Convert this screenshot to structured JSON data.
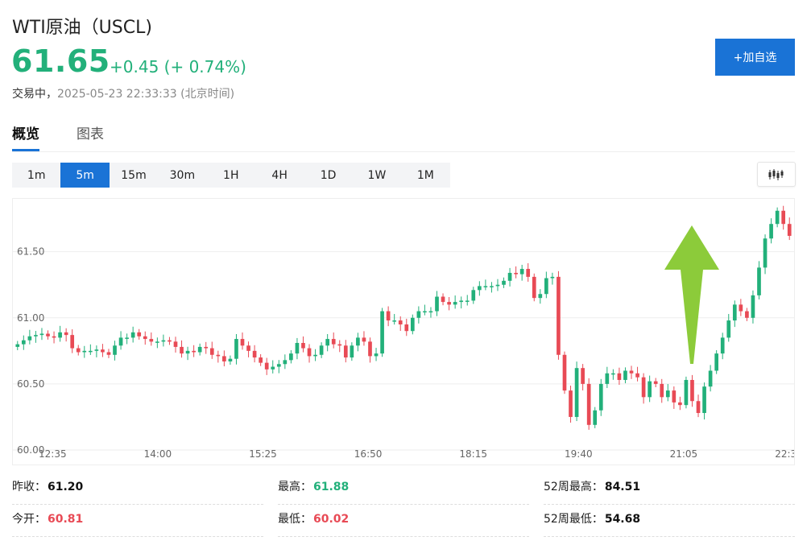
{
  "header": {
    "title": "WTI原油（USCL)",
    "price": "61.65",
    "change": "+0.45 (+ 0.74%)",
    "status_label": "交易中，",
    "timestamp": "2025-05-23 22:33:33 (北京时间)",
    "add_watch_label": "+加自选"
  },
  "tabs": [
    {
      "label": "概览",
      "active": true
    },
    {
      "label": "图表",
      "active": false
    }
  ],
  "intervals": [
    "1m",
    "5m",
    "15m",
    "30m",
    "1H",
    "4H",
    "1D",
    "1W",
    "1M"
  ],
  "active_interval": "5m",
  "chart_type_icon": "candlestick-icon",
  "colors": {
    "up": "#22b07a",
    "down": "#e84a55",
    "accent": "#1a73d6",
    "annotation_arrow": "#8ccb3a"
  },
  "chart_data": {
    "type": "candlestick",
    "y_ticks": [
      "61.50",
      "61.00",
      "60.50",
      "60.00"
    ],
    "x_ticks": [
      "12:35",
      "14:00",
      "15:25",
      "16:50",
      "18:15",
      "19:40",
      "21:05",
      "22:3"
    ],
    "ylim": [
      60.0,
      61.9
    ],
    "grid": true,
    "annotation": "green upward arrow above the candles near 21:10",
    "closes": [
      60.8,
      60.83,
      60.86,
      60.87,
      60.88,
      60.86,
      60.85,
      60.89,
      60.87,
      60.77,
      60.74,
      60.75,
      60.75,
      60.76,
      60.74,
      60.72,
      60.79,
      60.85,
      60.85,
      60.89,
      60.86,
      60.84,
      60.82,
      60.82,
      60.83,
      60.82,
      60.78,
      60.73,
      60.75,
      60.74,
      60.78,
      60.77,
      60.72,
      60.71,
      60.67,
      60.69,
      60.84,
      60.79,
      60.75,
      60.7,
      60.66,
      60.61,
      60.63,
      60.65,
      60.68,
      60.73,
      60.81,
      60.77,
      60.71,
      60.72,
      60.79,
      60.84,
      60.8,
      60.79,
      60.7,
      60.79,
      60.85,
      60.82,
      60.71,
      60.73,
      61.05,
      60.98,
      60.98,
      60.95,
      60.9,
      61.0,
      61.05,
      61.05,
      61.05,
      61.16,
      61.12,
      61.1,
      61.12,
      61.13,
      61.13,
      61.21,
      61.24,
      61.24,
      61.24,
      61.25,
      61.28,
      61.34,
      61.33,
      61.37,
      61.31,
      61.15,
      61.18,
      61.3,
      61.31,
      60.72,
      60.45,
      60.25,
      60.62,
      60.5,
      60.19,
      60.3,
      60.5,
      60.58,
      60.58,
      60.53,
      60.6,
      60.58,
      60.55,
      60.4,
      60.52,
      60.5,
      60.4,
      60.45,
      60.36,
      60.34,
      60.53,
      60.37,
      60.28,
      60.48,
      60.6,
      60.73,
      60.85,
      60.98,
      61.1,
      61.05,
      61.0,
      61.17,
      61.38,
      61.6,
      61.71,
      61.81,
      61.71,
      61.62
    ]
  },
  "stats": [
    {
      "label": "昨收：",
      "value": "61.20",
      "color": "dark"
    },
    {
      "label": "最高：",
      "value": "61.88",
      "color": "green"
    },
    {
      "label": "52周最高：",
      "value": "84.51",
      "color": "dark"
    },
    {
      "label": "今开：",
      "value": "60.81",
      "color": "red"
    },
    {
      "label": "最低：",
      "value": "60.02",
      "color": "red"
    },
    {
      "label": "52周最低：",
      "value": "54.68",
      "color": "dark"
    }
  ]
}
